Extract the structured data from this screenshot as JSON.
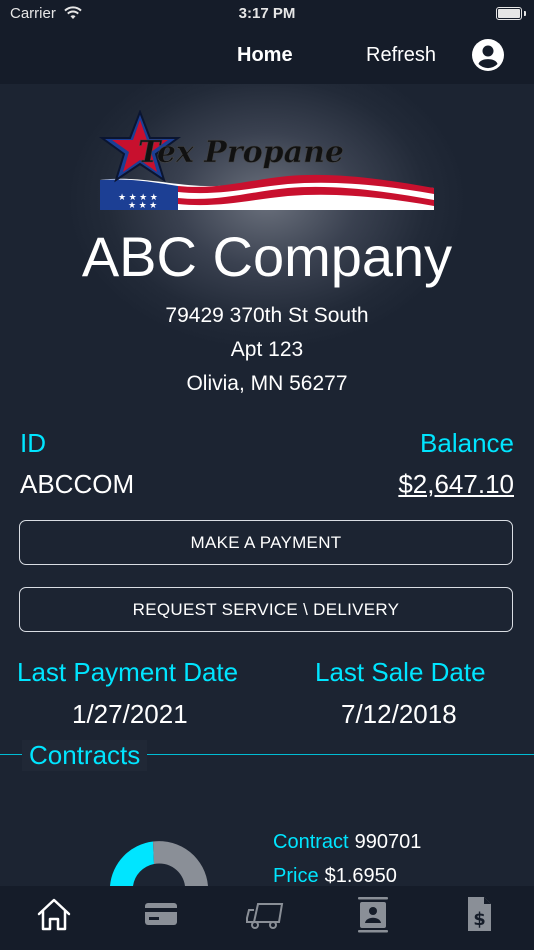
{
  "status_bar": {
    "carrier": "Carrier",
    "time": "3:17 PM"
  },
  "nav": {
    "home": "Home",
    "refresh": "Refresh",
    "profile_icon": "account-circle-icon"
  },
  "logo": {
    "text": "Tex Propane",
    "colors": {
      "red": "#c8102e",
      "blue": "#1c3f94"
    }
  },
  "account": {
    "company": "ABC Company",
    "address_line1": "79429 370th St South",
    "address_line2": "Apt 123",
    "address_line3": "Olivia, MN 56277",
    "id_label": "ID",
    "id_value": "ABCCOM",
    "balance_label": "Balance",
    "balance_value": "$2,647.10"
  },
  "actions": {
    "make_payment": "MAKE A PAYMENT",
    "request_service": "REQUEST SERVICE \\ DELIVERY"
  },
  "dates": {
    "last_payment_label": "Last Payment Date",
    "last_payment_value": "1/27/2021",
    "last_sale_label": "Last Sale Date",
    "last_sale_value": "7/12/2018"
  },
  "contracts": {
    "title": "Contracts",
    "contract_label": "Contract",
    "contract_value": "990701",
    "price_label": "Price",
    "price_value": "$1.6950"
  },
  "tabbar": {
    "icons": [
      "home-icon",
      "credit-card-icon",
      "delivery-truck-icon",
      "contact-card-icon",
      "invoice-dollar-icon"
    ],
    "active": "home-icon"
  },
  "theme": {
    "accent": "#00e5ff",
    "nav_bg": "#151c29",
    "donut_gray": "#8a8f97"
  }
}
